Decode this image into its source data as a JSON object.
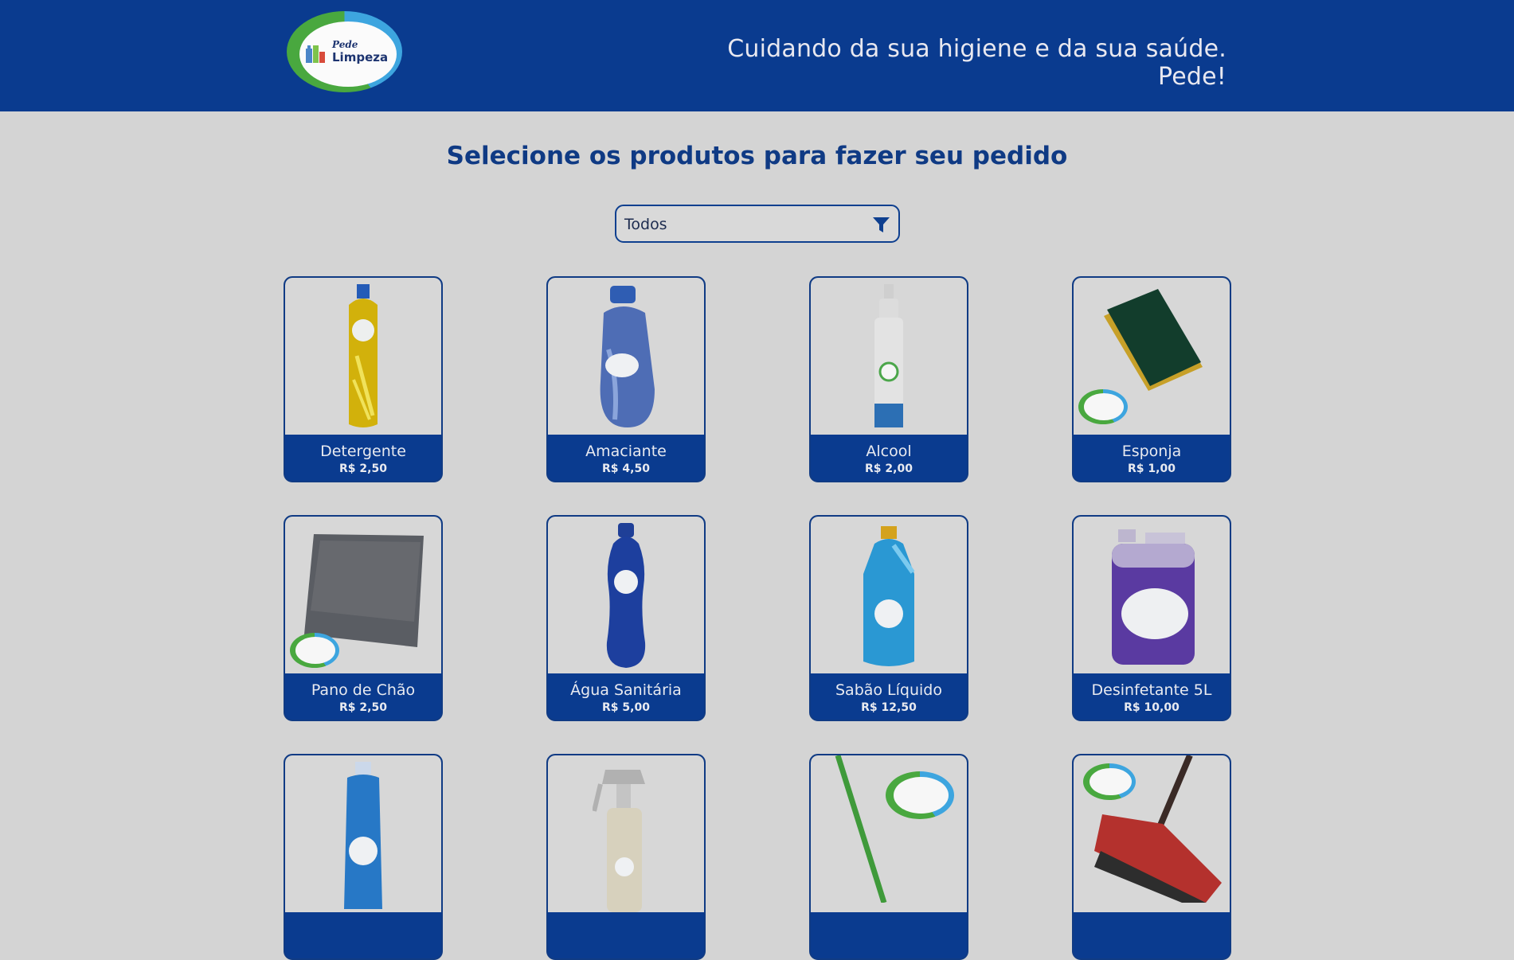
{
  "header": {
    "logo": {
      "line1": "Pede",
      "line2": "Limpeza"
    },
    "tagline": "Cuidando da sua higiene e da sua saúde. Pede!"
  },
  "main": {
    "title": "Selecione os produtos para fazer seu pedido",
    "filter": {
      "selected": "Todos"
    }
  },
  "products": [
    {
      "name": "Detergente",
      "price": "R$ 2,50",
      "image": "detergente-bottle"
    },
    {
      "name": "Amaciante",
      "price": "R$ 4,50",
      "image": "amaciante-bottle"
    },
    {
      "name": "Alcool",
      "price": "R$ 2,00",
      "image": "alcool-spray"
    },
    {
      "name": "Esponja",
      "price": "R$ 1,00",
      "image": "esponja"
    },
    {
      "name": "Pano de Chão",
      "price": "R$ 2,50",
      "image": "pano-de-chao"
    },
    {
      "name": "Água Sanitária",
      "price": "R$ 5,00",
      "image": "agua-sanitaria-bottle"
    },
    {
      "name": "Sabão Líquido",
      "price": "R$ 12,50",
      "image": "sabao-liquido-bottle"
    },
    {
      "name": "Desinfetante 5L",
      "price": "R$ 10,00",
      "image": "desinfetante-gallon"
    },
    {
      "name": "",
      "price": "",
      "image": "blue-bottle"
    },
    {
      "name": "",
      "price": "",
      "image": "spray-bottle"
    },
    {
      "name": "",
      "price": "",
      "image": "green-broom"
    },
    {
      "name": "",
      "price": "",
      "image": "red-broom"
    }
  ],
  "colors": {
    "header": "#0a3b8f",
    "accent": "#0f3a84",
    "background": "#d4d4d4"
  }
}
